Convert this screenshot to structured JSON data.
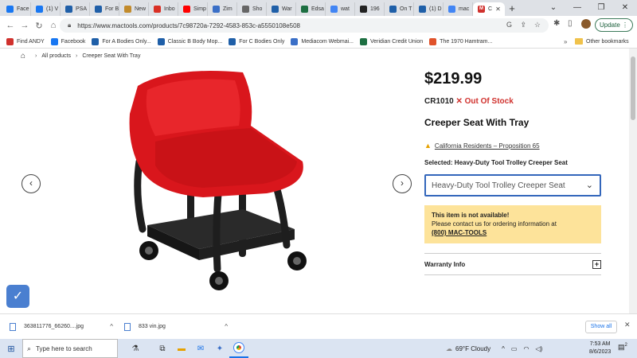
{
  "browser": {
    "tabs": [
      {
        "label": "Face",
        "color": "#1877f2"
      },
      {
        "label": "(1) V",
        "color": "#1877f2"
      },
      {
        "label": "PSA",
        "color": "#1f5fa8"
      },
      {
        "label": "For B",
        "color": "#1f5fa8"
      },
      {
        "label": "New",
        "color": "#c28b2c"
      },
      {
        "label": "Inbo",
        "color": "#d93025"
      },
      {
        "label": "Simp",
        "color": "#ff0000"
      },
      {
        "label": "Zim",
        "color": "#3a6fc7"
      },
      {
        "label": "Sho",
        "color": "#666666"
      },
      {
        "label": "War",
        "color": "#1f5fa8"
      },
      {
        "label": "Edsa",
        "color": "#1d6f42"
      },
      {
        "label": "wat",
        "color": "#4285f4"
      },
      {
        "label": "196",
        "color": "#222222"
      },
      {
        "label": "On T",
        "color": "#1f5fa8"
      },
      {
        "label": "(1) D",
        "color": "#1f5fa8"
      },
      {
        "label": "mac",
        "color": "#4285f4"
      }
    ],
    "active_tab": {
      "label": "C",
      "color": "#d0312d"
    },
    "new_tab": "+",
    "url": "https://www.mactools.com/products/7c98720a-7292-4583-853c-a5550108e508",
    "update_label": "Update",
    "bookmarks": [
      {
        "label": "Find ANDY",
        "color": "#d0312d"
      },
      {
        "label": "Facebook",
        "color": "#1877f2"
      },
      {
        "label": "For A Bodies Only...",
        "color": "#1f5fa8"
      },
      {
        "label": "Classic B Body Mop...",
        "color": "#1f5fa8"
      },
      {
        "label": "For C Bodies Only",
        "color": "#1f5fa8"
      },
      {
        "label": "Mediacom Webmai...",
        "color": "#3a6fc7"
      },
      {
        "label": "Veridian Credit Union",
        "color": "#1d6f42"
      },
      {
        "label": "The 1970 Hamtram...",
        "color": "#e0522a"
      }
    ],
    "other_bookmarks": "Other bookmarks"
  },
  "page": {
    "breadcrumb": {
      "all_products": "All products",
      "current": "Creeper Seat With Tray"
    },
    "price": "$219.99",
    "sku": "CR1010",
    "stock_status": "Out Of Stock",
    "title": "Creeper Seat With Tray",
    "proposition": "California Residents – Proposition 65",
    "selected_label": "Selected: Heavy-Duty Tool Trolley Creeper Seat",
    "select_value": "Heavy-Duty Tool Trolley Creeper Seat",
    "notice": {
      "title": "This item is not available!",
      "body": "Please contact us for ordering information at",
      "phone": "(800) MAC-TOOLS"
    },
    "warranty_label": "Warranty Info",
    "colors": {
      "seat_red": "#d9161c",
      "frame": "#1e1e1e",
      "notice_bg": "#fde39a"
    }
  },
  "downloads": {
    "items": [
      "363811776_66260....jpg",
      "833 vin.jpg"
    ],
    "show_all": "Show all"
  },
  "taskbar": {
    "search_placeholder": "Type here to search",
    "weather": "69°F  Cloudy",
    "time": "7:53 AM",
    "date": "8/6/2023",
    "notifications": "2"
  }
}
